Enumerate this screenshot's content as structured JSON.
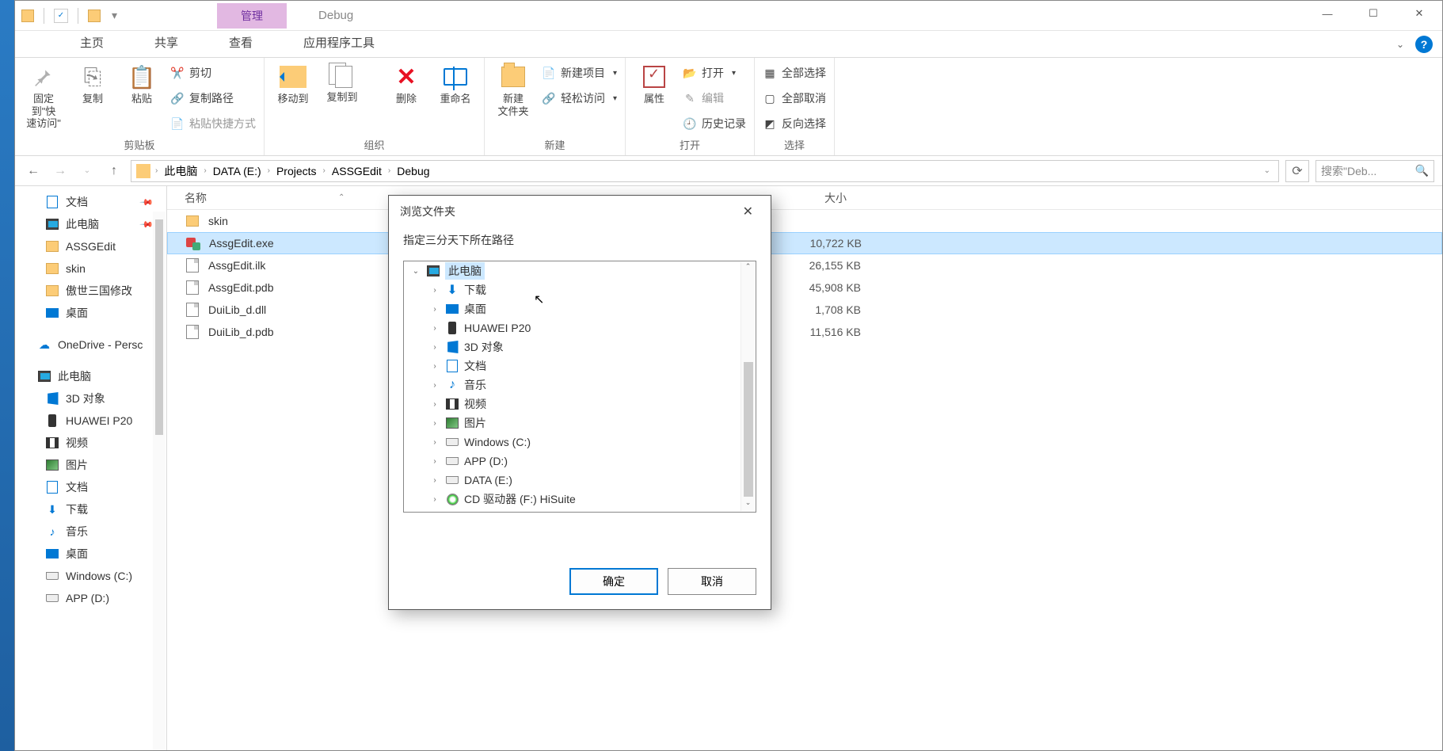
{
  "window": {
    "contextTab": "管理",
    "title": "Debug"
  },
  "tabs": {
    "home": "主页",
    "share": "共享",
    "view": "查看",
    "tools": "应用程序工具"
  },
  "ribbon": {
    "clipboard": {
      "label": "剪贴板",
      "pin": "固定到\"快\n速访问\"",
      "copy": "复制",
      "paste": "粘贴",
      "cut": "剪切",
      "copyPath": "复制路径",
      "pasteShortcut": "粘贴快捷方式"
    },
    "organize": {
      "label": "组织",
      "moveTo": "移动到",
      "copyTo": "复制到",
      "delete": "删除",
      "rename": "重命名"
    },
    "new": {
      "label": "新建",
      "newFolder": "新建\n文件夹",
      "newItem": "新建项目",
      "easyAccess": "轻松访问"
    },
    "open": {
      "label": "打开",
      "properties": "属性",
      "open": "打开",
      "edit": "编辑",
      "history": "历史记录"
    },
    "select": {
      "label": "选择",
      "selectAll": "全部选择",
      "selectNone": "全部取消",
      "invert": "反向选择"
    }
  },
  "breadcrumb": {
    "pc": "此电脑",
    "drive": "DATA (E:)",
    "p1": "Projects",
    "p2": "ASSGEdit",
    "p3": "Debug"
  },
  "search": {
    "placeholder": "搜索\"Deb..."
  },
  "columns": {
    "name": "名称",
    "size": "大小"
  },
  "navpane": {
    "docs": "文档",
    "pc": "此电脑",
    "assgedit": "ASSGEdit",
    "skin": "skin",
    "aoshi": "傲世三国修改",
    "desktop": "桌面",
    "onedrive": "OneDrive - Persc",
    "pcHeader": "此电脑",
    "d3": "3D 对象",
    "huawei": "HUAWEI P20",
    "video": "视频",
    "images": "图片",
    "docs2": "文档",
    "downloads": "下载",
    "music": "音乐",
    "desktop2": "桌面",
    "winc": "Windows (C:)",
    "appd": "APP (D:)"
  },
  "files": [
    {
      "name": "skin",
      "type": "folder",
      "size": ""
    },
    {
      "name": "AssgEdit.exe",
      "type": "exe",
      "size": "10,722 KB",
      "selected": true
    },
    {
      "name": "AssgEdit.ilk",
      "type": "file",
      "size": "26,155 KB"
    },
    {
      "name": "AssgEdit.pdb",
      "type": "file",
      "size": "45,908 KB"
    },
    {
      "name": "DuiLib_d.dll",
      "type": "file",
      "size": "1,708 KB"
    },
    {
      "name": "DuiLib_d.pdb",
      "type": "file",
      "size": "11,516 KB"
    }
  ],
  "dialog": {
    "title": "浏览文件夹",
    "prompt": "指定三分天下所在路径",
    "tree": {
      "root": "此电脑",
      "items": [
        {
          "label": "下载",
          "icon": "down"
        },
        {
          "label": "桌面",
          "icon": "desk"
        },
        {
          "label": "HUAWEI P20",
          "icon": "phone"
        },
        {
          "label": "3D 对象",
          "icon": "d3"
        },
        {
          "label": "文档",
          "icon": "doc"
        },
        {
          "label": "音乐",
          "icon": "mus"
        },
        {
          "label": "视频",
          "icon": "vid"
        },
        {
          "label": "图片",
          "icon": "img"
        },
        {
          "label": "Windows (C:)",
          "icon": "disk"
        },
        {
          "label": "APP (D:)",
          "icon": "disk"
        },
        {
          "label": "DATA (E:)",
          "icon": "disk"
        },
        {
          "label": "CD 驱动器 (F:) HiSuite",
          "icon": "cd"
        }
      ]
    },
    "ok": "确定",
    "cancel": "取消"
  }
}
